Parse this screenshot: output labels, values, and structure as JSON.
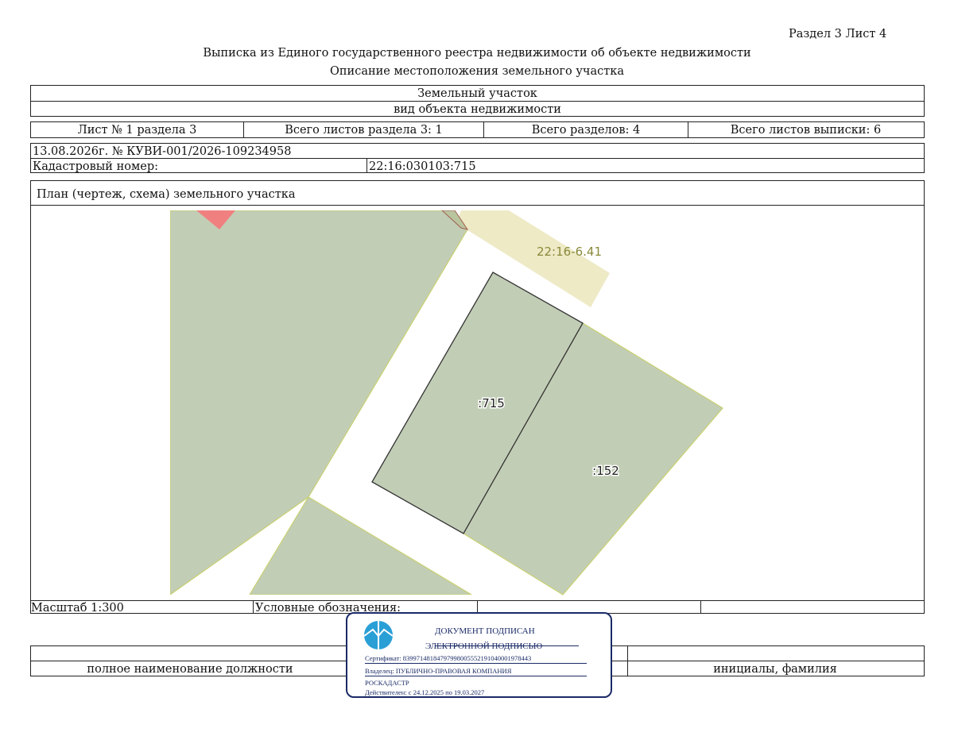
{
  "header": {
    "section_sheet": "Раздел 3    Лист 4",
    "title": "Выписка из Единого государственного реестра недвижимости об объекте недвижимости",
    "subtitle": "Описание местоположения земельного участка"
  },
  "object": {
    "name": "Земельный участок",
    "kind_caption": "вид объекта недвижимости"
  },
  "sheet_info": {
    "sheet": "Лист № 1 раздела 3",
    "total_section_sheets": "Всего листов раздела 3: 1",
    "total_sections": "Всего разделов: 4",
    "total_sheets": "Всего листов выписки: 6"
  },
  "record": {
    "date_number": "13.08.2026г. № КУВИ-001/2026-109234958",
    "cadastral_label": "Кадастровый номер:",
    "cadastral_number": "22:16:030103:715"
  },
  "plan": {
    "caption": "План (чертеж, схема) земельного участка",
    "labels": {
      "zone": "22:16-6.41",
      "parcel_main": ":715",
      "parcel_neighbor": ":152"
    }
  },
  "legend_row": {
    "scale": "Масштаб 1:300",
    "legend": "Условные обозначения:"
  },
  "signature_row": {
    "position_caption": "полное наименование должности",
    "name_caption": "инициалы, фамилия"
  },
  "stamp": {
    "line1": "ДОКУМЕНТ ПОДПИСАН",
    "line2": "ЭЛЕКТРОННОЙ ПОДПИСЬЮ",
    "certificate": "Сертификат: 83997148184797998005552191040001978443",
    "owner": "Владелец: ПУБЛИЧНО-ПРАВОВАЯ КОМПАНИЯ",
    "owner2": "РОСКАДАСТР",
    "valid": "Действителен: с 24.12.2025 по 19.03.2027",
    "icon": "rosreestr-logo-icon"
  },
  "colors": {
    "parcel_fill": "#c2cdb6",
    "zone_fill": "#eeeac6",
    "zone_text": "#8a8a3a",
    "highlight": "#f08080",
    "stamp_border": "#1a2a66",
    "stamp_logo": "#2a9fd6"
  }
}
